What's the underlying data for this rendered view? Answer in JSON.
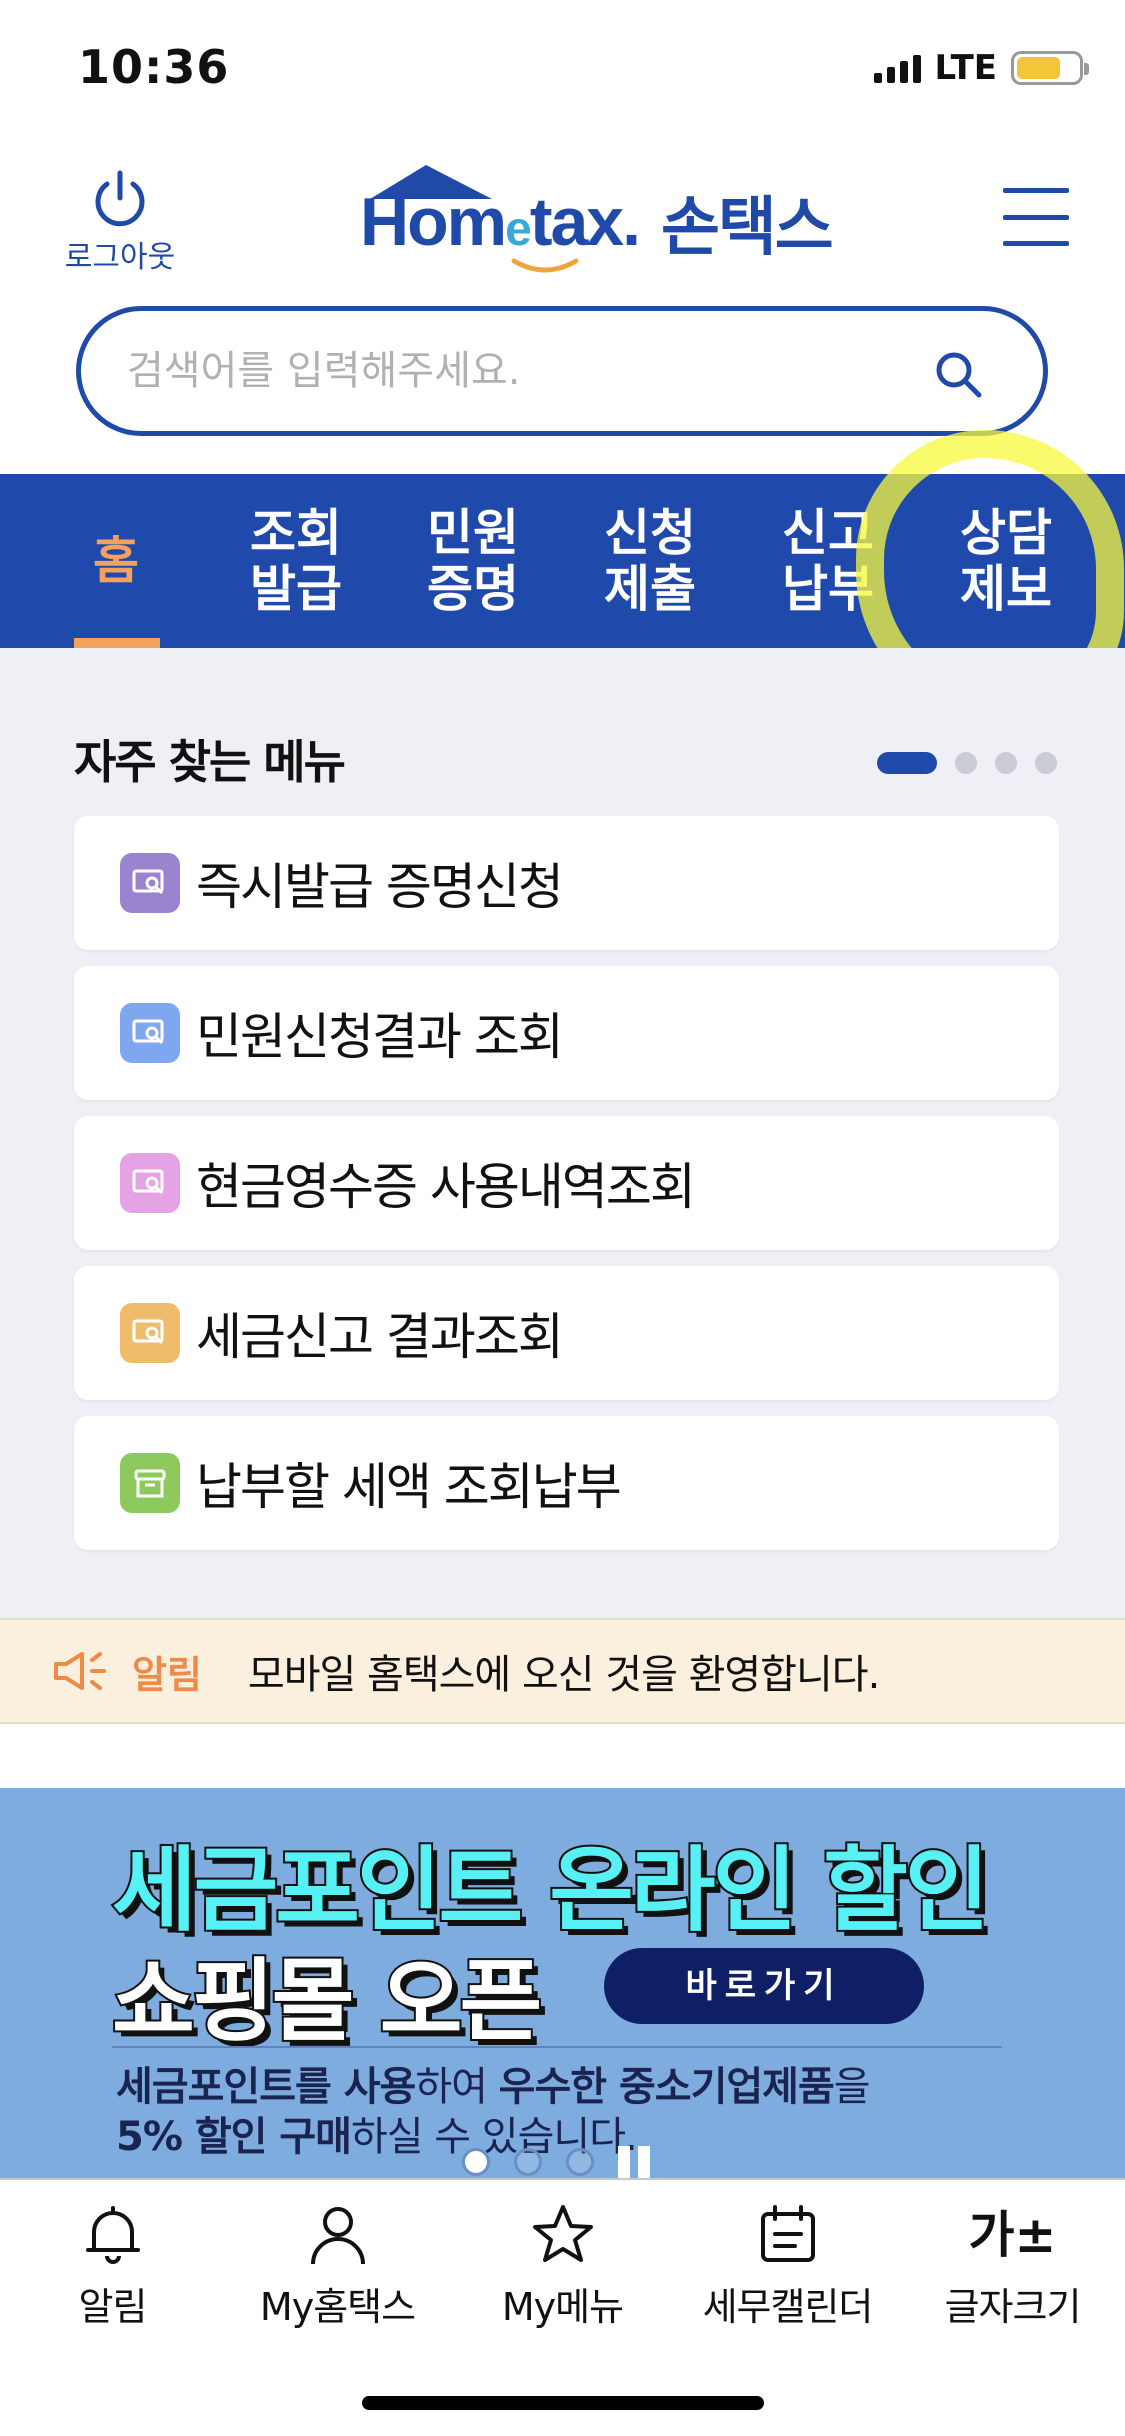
{
  "status_bar": {
    "time": "10:36",
    "network": "LTE"
  },
  "header": {
    "logout_label": "로그아웃",
    "logo_en_part1": "Hom",
    "logo_en_e": "e",
    "logo_en_part2": "tax.",
    "logo_ko": "손택스"
  },
  "search": {
    "placeholder": "검색어를 입력해주세요.",
    "value": ""
  },
  "tabs": [
    {
      "label": "홈",
      "active": true
    },
    {
      "label": "조회\n발급"
    },
    {
      "label": "민원\n증명"
    },
    {
      "label": "신청\n제출"
    },
    {
      "label": "신고\n납부"
    },
    {
      "label": "상담\n제보"
    }
  ],
  "favorites": {
    "title": "자주 찾는 메뉴",
    "page_dots": 4,
    "active_dot": 0,
    "items": [
      {
        "label": "즉시발급 증명신청",
        "icon": "document-search-icon",
        "color": "#9a84cf"
      },
      {
        "label": "민원신청결과 조회",
        "icon": "document-search-icon",
        "color": "#7fa7f0"
      },
      {
        "label": "현금영수증 사용내역조회",
        "icon": "document-search-icon",
        "color": "#e3a3e4"
      },
      {
        "label": "세금신고 결과조회",
        "icon": "document-search-icon",
        "color": "#efbc6b"
      },
      {
        "label": "납부할 세액 조회납부",
        "icon": "box-icon",
        "color": "#8dc95d"
      }
    ]
  },
  "notice": {
    "label": "알림",
    "text": "모바일 홈택스에 오신 것을 환영합니다."
  },
  "banner": {
    "line1": "세금포인트 온라인 할인",
    "line2": "쇼핑몰 오픈",
    "button": "바로가기",
    "sub1_bold1": "세금포인트를 사용",
    "sub1_rest1": "하여 ",
    "sub1_bold2": "우수한 중소기업제품",
    "sub1_rest2": "을",
    "sub2_bold": "5% 할인 구매",
    "sub2_rest": "하실 수 있습니다.",
    "slides": 3,
    "active_slide": 0
  },
  "bottom_nav": [
    {
      "label": "알림",
      "icon": "bell-icon"
    },
    {
      "label": "My홈택스",
      "icon": "person-icon"
    },
    {
      "label": "My메뉴",
      "icon": "star-icon"
    },
    {
      "label": "세무캘린더",
      "icon": "calendar-icon"
    },
    {
      "label": "글자크기",
      "icon": "font-size-icon",
      "glyph": "가±"
    }
  ],
  "colors": {
    "brand_blue": "#2049ac",
    "active_tab": "#f3a15d",
    "highlight": "#f8f83c",
    "notice_bg": "#fbf0de",
    "banner_bg": "#7eacde"
  }
}
